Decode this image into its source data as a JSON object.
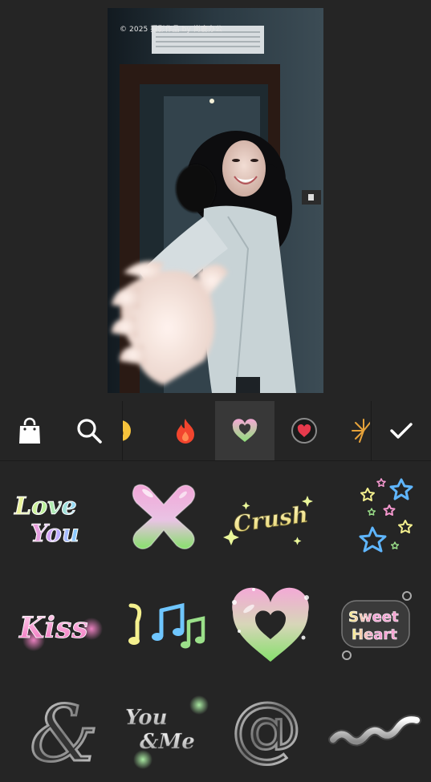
{
  "preview": {
    "watermark": "© 2025 摄影作品 by 尚鹿办公"
  },
  "toolbar": {
    "shop_icon": "shopping-bag-icon",
    "search_icon": "search-icon",
    "confirm_icon": "checkmark-icon",
    "category_tabs": [
      {
        "icon": "emoji-face-icon",
        "active": false
      },
      {
        "icon": "fire-icon",
        "active": false
      },
      {
        "icon": "heart-bubble-icon",
        "active": true
      },
      {
        "icon": "heart-badge-icon",
        "active": false
      },
      {
        "icon": "firework-icon",
        "active": false
      }
    ]
  },
  "stickers": {
    "love_you": {
      "line1": "Love",
      "line2": "You"
    },
    "x": {
      "glyph": "X"
    },
    "crush": {
      "text": "Crush"
    },
    "stars": {
      "icon": "stars-icon"
    },
    "kiss": {
      "text": "Kiss"
    },
    "notes": {
      "icon": "music-notes-icon"
    },
    "heart": {
      "icon": "bubble-heart-icon"
    },
    "sweet_heart": {
      "line1": "Sweet",
      "line2": "Heart"
    },
    "ampersand": {
      "glyph": "&"
    },
    "you_me": {
      "line1": "You",
      "line2": "&Me"
    },
    "at": {
      "glyph": "@"
    },
    "squiggle": {
      "icon": "squiggle-icon"
    }
  },
  "colors": {
    "background": "#252525",
    "active_tab": "#383838",
    "pink": "#f48fc8",
    "green": "#8ee07a",
    "blue": "#6fc6ff",
    "yellow": "#f4f09a",
    "chrome": "#c9c9c9"
  }
}
